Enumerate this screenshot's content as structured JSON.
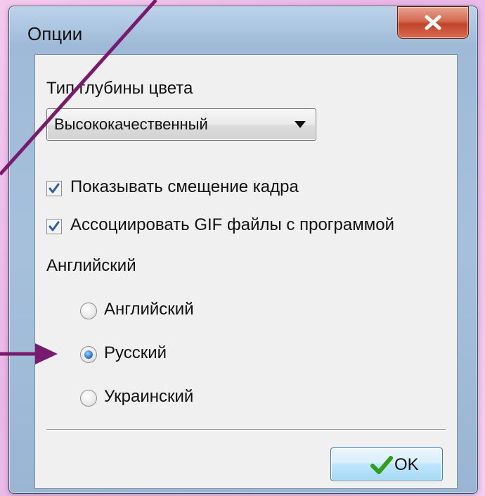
{
  "window": {
    "title": "Опции"
  },
  "color_depth": {
    "label": "Тип глубины цвета",
    "selected": "Высококачественный"
  },
  "checkboxes": [
    {
      "label": "Показывать смещение кадра",
      "checked": true
    },
    {
      "label": "Ассоциировать GIF файлы с программой",
      "checked": true
    }
  ],
  "language": {
    "group_label": "Английский",
    "options": [
      {
        "label": "Английский",
        "selected": false
      },
      {
        "label": "Русский",
        "selected": true
      },
      {
        "label": "Украинский",
        "selected": false
      }
    ]
  },
  "buttons": {
    "ok_label": "OK"
  },
  "colors": {
    "annotation_arrow": "#7a1a6f",
    "ok_check": "#2f9e1a"
  }
}
